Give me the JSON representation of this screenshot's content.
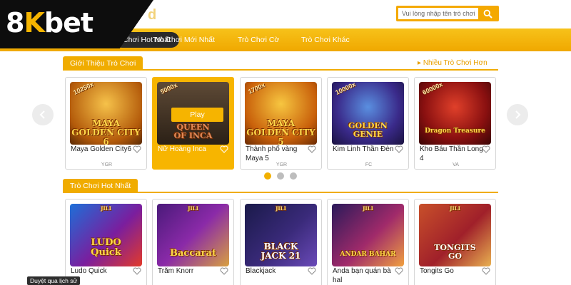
{
  "brand": {
    "logo_prefix": "8",
    "logo_k": "K",
    "logo_suffix": "bet",
    "ghost_text": "d"
  },
  "search": {
    "placeholder": "Vui lòng nhập tên trò chơi."
  },
  "nav": {
    "tabs": [
      {
        "label": "Chơi Hot Nhất"
      },
      {
        "label": "Trò Chơi Mới Nhất"
      },
      {
        "label": "Trò Chơi Cờ"
      },
      {
        "label": "Trò Chơi Khác"
      }
    ]
  },
  "intro": {
    "heading": "Giới Thiệu Trò Chơi",
    "more_link": "Nhiều Trò Chơi Hơn",
    "games": [
      {
        "title": "Maya Golden City6",
        "provider": "YGR",
        "art_text": "MAYA\nGOLDEN CITY 6",
        "multiplier": "10250x"
      },
      {
        "title": "Nữ Hoàng Inca",
        "provider": "",
        "art_text": "QUEEN\nOF INCA",
        "multiplier": "5000x",
        "play_label": "Play",
        "highlighted": true
      },
      {
        "title": "Thành phố vàng Maya 5",
        "provider": "YGR",
        "art_text": "MAYA\nGOLDEN CITY 5",
        "multiplier": "1700x"
      },
      {
        "title": "Kim Linh Thần Đèn",
        "provider": "FC",
        "art_text": "GOLDEN\nGENIE",
        "multiplier": "10000x"
      },
      {
        "title": "Kho Báu Thần Long 4",
        "provider": "VA",
        "art_text": "Dragon Treasure",
        "multiplier": "60000x"
      }
    ],
    "page_dots": 3,
    "active_dot": 0
  },
  "hot": {
    "heading": "Trò Chơi Hot Nhất",
    "games": [
      {
        "title": "Ludo Quick",
        "badge": "JILI",
        "art_text": "LUDO\nQuick"
      },
      {
        "title": "Trăm Knorr",
        "badge": "JILI",
        "art_text": "Baccarat"
      },
      {
        "title": "Blackjack",
        "badge": "JILI",
        "art_text": "BLACK\nJACK 21"
      },
      {
        "title": "Anda bạn quán bà hal",
        "badge": "JILI",
        "art_text": "ANDAR BAHAR"
      },
      {
        "title": "Tongits Go",
        "badge": "JILI",
        "art_text": "TONGITS\nGO"
      }
    ]
  },
  "status_tooltip": "Duyệt qua lịch sử",
  "colors": {
    "accent": "#f0ac00",
    "nav_active": "#2a2a2a",
    "logo_band": "#0d0d0d"
  }
}
